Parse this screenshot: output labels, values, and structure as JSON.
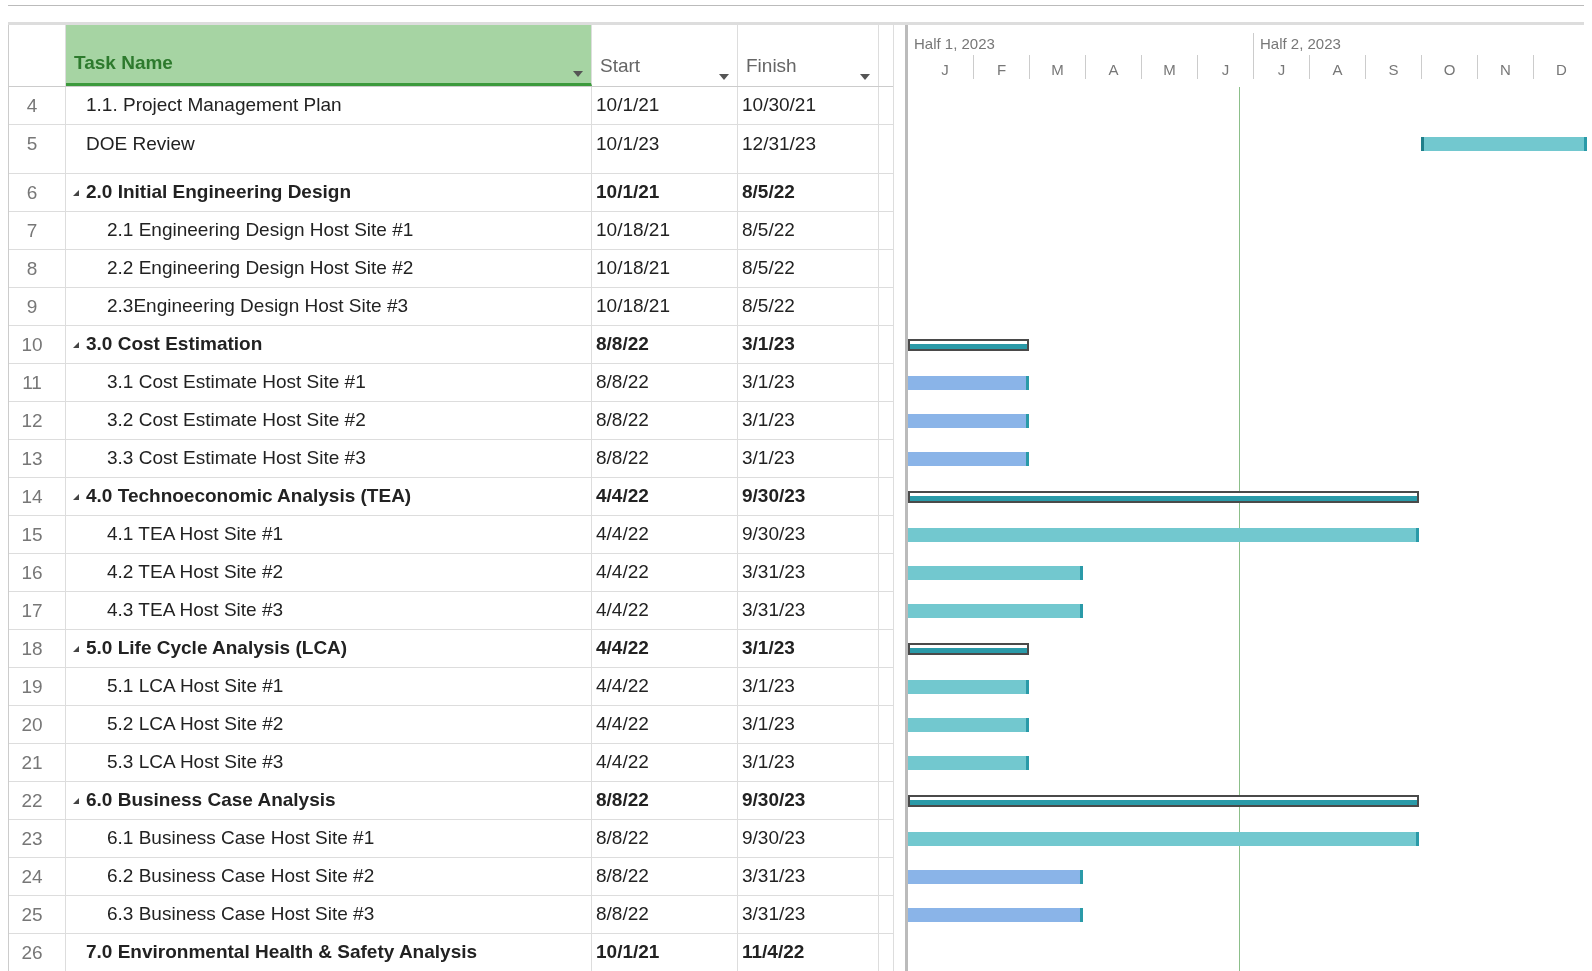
{
  "columns": [
    {
      "label": "Task Name",
      "selected": true
    },
    {
      "label": "Start",
      "selected": false
    },
    {
      "label": "Finish",
      "selected": false
    }
  ],
  "timescale": {
    "halves": [
      "Half 1, 2023",
      "Half 2, 2023"
    ],
    "months": [
      "J",
      "F",
      "M",
      "A",
      "M",
      "J",
      "J",
      "A",
      "S",
      "O",
      "N",
      "D"
    ]
  },
  "rows": [
    {
      "id": "4",
      "name": "1.1. Project Management Plan",
      "start": "10/1/21",
      "finish": "10/30/21",
      "kind": "task"
    },
    {
      "id": "5",
      "name": "DOE Review",
      "start": "10/1/23",
      "finish": "12/31/23",
      "kind": "task",
      "color": "#72c8cf"
    },
    {
      "id": "6",
      "name": "2.0 Initial Engineering Design",
      "start": "10/1/21",
      "finish": "8/5/22",
      "kind": "summary",
      "expanded": true,
      "children": [
        {
          "id": "7",
          "name": "2.1 Engineering Design Host Site #1",
          "start": "10/18/21",
          "finish": "8/5/22",
          "kind": "task"
        },
        {
          "id": "8",
          "name": "2.2 Engineering Design Host Site #2",
          "start": "10/18/21",
          "finish": "8/5/22",
          "kind": "task"
        },
        {
          "id": "9",
          "name": "2.3Engineering Design Host Site #3",
          "start": "10/18/21",
          "finish": "8/5/22",
          "kind": "task"
        }
      ]
    },
    {
      "id": "10",
      "name": "3.0 Cost Estimation",
      "start": "8/8/22",
      "finish": "3/1/23",
      "kind": "summary",
      "expanded": true,
      "color": "#2a9aa8",
      "children": [
        {
          "id": "11",
          "name": "3.1 Cost Estimate Host Site #1",
          "start": "8/8/22",
          "finish": "3/1/23",
          "kind": "task",
          "color": "#8ab4e8"
        },
        {
          "id": "12",
          "name": "3.2 Cost Estimate Host Site #2",
          "start": "8/8/22",
          "finish": "3/1/23",
          "kind": "task",
          "color": "#8ab4e8"
        },
        {
          "id": "13",
          "name": "3.3 Cost Estimate Host Site #3",
          "start": "8/8/22",
          "finish": "3/1/23",
          "kind": "task",
          "color": "#8ab4e8"
        }
      ]
    },
    {
      "id": "14",
      "name": "4.0 Technoeconomic Analysis (TEA)",
      "start": "4/4/22",
      "finish": "9/30/23",
      "kind": "summary",
      "expanded": true,
      "color": "#2a9aa8",
      "children": [
        {
          "id": "15",
          "name": "4.1 TEA Host Site #1",
          "start": "4/4/22",
          "finish": "9/30/23",
          "kind": "task",
          "color": "#72c8cf"
        },
        {
          "id": "16",
          "name": "4.2 TEA Host Site #2",
          "start": "4/4/22",
          "finish": "3/31/23",
          "kind": "task",
          "color": "#72c8cf"
        },
        {
          "id": "17",
          "name": "4.3 TEA Host Site #3",
          "start": "4/4/22",
          "finish": "3/31/23",
          "kind": "task",
          "color": "#72c8cf"
        }
      ]
    },
    {
      "id": "18",
      "name": "5.0 Life Cycle Analysis (LCA)",
      "start": "4/4/22",
      "finish": "3/1/23",
      "kind": "summary",
      "expanded": true,
      "color": "#2a9aa8",
      "children": [
        {
          "id": "19",
          "name": "5.1 LCA Host Site #1",
          "start": "4/4/22",
          "finish": "3/1/23",
          "kind": "task",
          "color": "#72c8cf"
        },
        {
          "id": "20",
          "name": "5.2 LCA Host Site #2",
          "start": "4/4/22",
          "finish": "3/1/23",
          "kind": "task",
          "color": "#72c8cf"
        },
        {
          "id": "21",
          "name": "5.3 LCA Host Site #3",
          "start": "4/4/22",
          "finish": "3/1/23",
          "kind": "task",
          "color": "#72c8cf"
        }
      ]
    },
    {
      "id": "22",
      "name": "6.0 Business Case Analysis",
      "start": "8/8/22",
      "finish": "9/30/23",
      "kind": "summary",
      "expanded": true,
      "color": "#2a9aa8",
      "children": [
        {
          "id": "23",
          "name": "6.1 Business Case Host Site #1",
          "start": "8/8/22",
          "finish": "9/30/23",
          "kind": "task",
          "color": "#72c8cf"
        },
        {
          "id": "24",
          "name": "6.2 Business Case Host Site #2",
          "start": "8/8/22",
          "finish": "3/31/23",
          "kind": "task",
          "color": "#8ab4e8"
        },
        {
          "id": "25",
          "name": "6.3 Business Case Host Site #3",
          "start": "8/8/22",
          "finish": "3/31/23",
          "kind": "task",
          "color": "#8ab4e8"
        }
      ]
    },
    {
      "id": "26",
      "name": "7.0 Environmental Health & Safety Analysis",
      "start": "10/1/21",
      "finish": "11/4/22",
      "kind": "summary"
    }
  ]
}
